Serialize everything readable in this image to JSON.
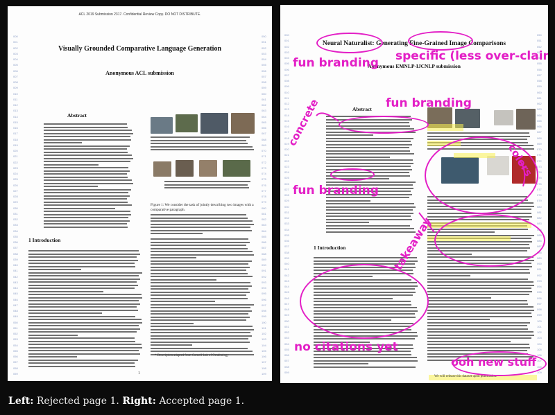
{
  "left_page": {
    "header": "ACL 2019 Submission 2317. Confidential Review Copy. DO NOT DISTRIBUTE.",
    "title": "Visually Grounded Comparative Language Generation",
    "author": "Anonymous ACL submission",
    "abstract_heading": "Abstract",
    "intro_heading": "1   Introduction",
    "figure_caption": "Figure 1: We consider the task of jointly describing two images with a comparative paragraph.",
    "page_number": "1",
    "footnote": "* Description adapted from Cornell Lab of Ornithology"
  },
  "right_page": {
    "title": "Neural Naturalist: Generating Fine-Grained Image Comparisons",
    "author": "Anonymous EMNLP-IJCNLP submission",
    "abstract_heading": "Abstract",
    "intro_heading": "1   Introduction",
    "release_note": "We will release this dataset upon publication."
  },
  "annotations": {
    "fun_branding_1": "fun branding",
    "specific": "specific (less over-claiming)",
    "fun_branding_2": "fun branding",
    "concrete": "concrete",
    "colors": "colors",
    "fun_branding_3": "fun branding",
    "takeaway": "takeaway",
    "no_citations": "no citations yet",
    "ooh_new": "ooh new stuff"
  },
  "caption": {
    "left_label": "Left:",
    "left_text": " Rejected page 1. ",
    "right_label": "Right:",
    "right_text": " Accepted page 1."
  },
  "colors": {
    "annotation": "#e31fc6",
    "highlight": "#faf050"
  }
}
